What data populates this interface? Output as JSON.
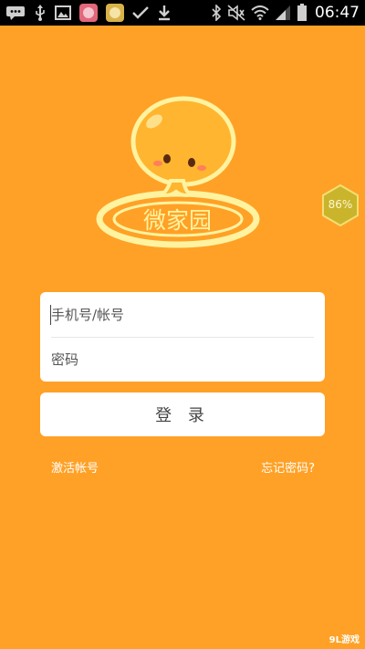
{
  "status_bar": {
    "time": "06:47",
    "icons": [
      "chat-icon",
      "usb-icon",
      "image-icon",
      "app-icon",
      "app-icon",
      "check-icon",
      "download-icon",
      "bluetooth-icon",
      "mute-icon",
      "wifi-icon",
      "signal-icon",
      "battery-icon"
    ]
  },
  "logo": {
    "text": "微家园"
  },
  "float_badge": {
    "percent": "86%"
  },
  "login": {
    "account_placeholder": "手机号/帐号",
    "password_placeholder": "密码",
    "login_label": "登 录",
    "activate_link": "激活帐号",
    "forgot_link": "忘记密码?"
  },
  "watermark": {
    "text": "9L游戏"
  },
  "colors": {
    "background": "#ffa126",
    "card": "#ffffff",
    "logo_ring": "#fff3a0",
    "badge": "#c9b42c"
  }
}
